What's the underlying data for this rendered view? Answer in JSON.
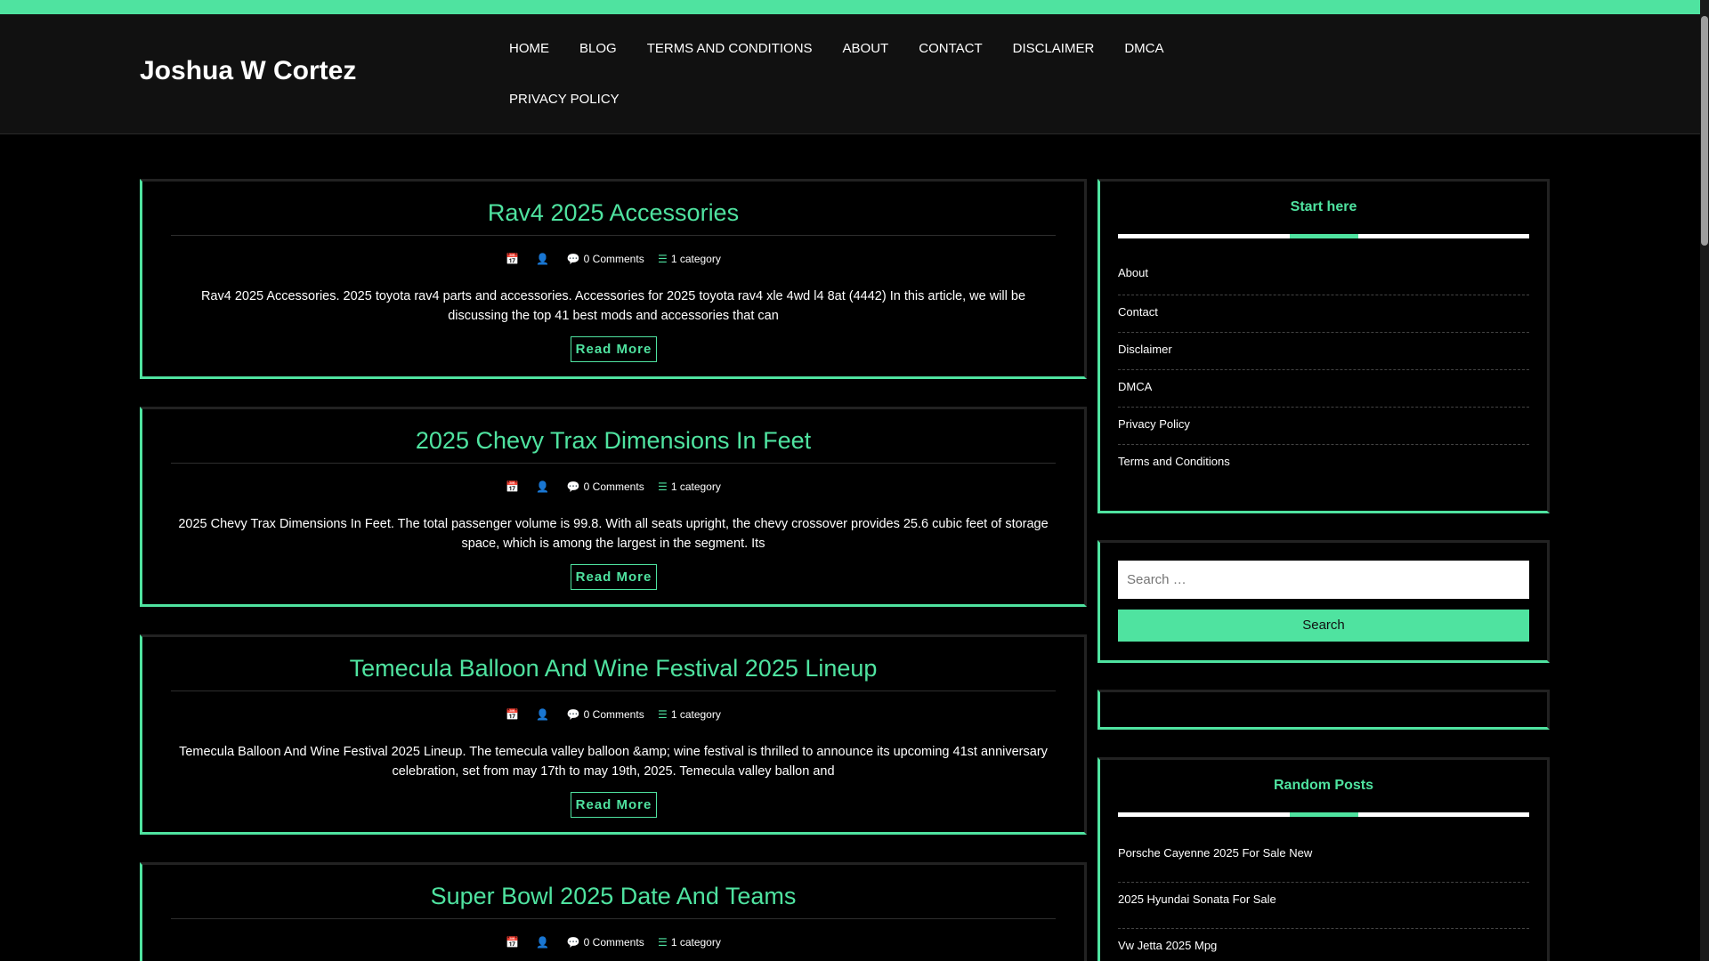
{
  "site": {
    "title": "Joshua W Cortez"
  },
  "nav": {
    "items": [
      "HOME",
      "BLOG",
      "TERMS AND CONDITIONS",
      "ABOUT",
      "CONTACT",
      "DISCLAIMER",
      "DMCA",
      "PRIVACY POLICY"
    ]
  },
  "posts": [
    {
      "title": "Rav4 2025 Accessories",
      "comments": "0 Comments",
      "category": "1 category",
      "excerpt": "Rav4 2025 Accessories. 2025 toyota rav4 parts and accessories. Accessories for 2025 toyota rav4 xle 4wd l4 8at (4442) In this article, we will be discussing the top 41 best mods and accessories that can",
      "read_more": "Read More"
    },
    {
      "title": "2025 Chevy Trax Dimensions In Feet",
      "comments": "0 Comments",
      "category": "1 category",
      "excerpt": "2025 Chevy Trax Dimensions In Feet. The total passenger volume is 99.8. With all seats upright, the chevy crossover provides 25.6 cubic feet of storage space, which is among the largest in the segment. Its",
      "read_more": "Read More"
    },
    {
      "title": "Temecula Balloon And Wine Festival 2025 Lineup",
      "comments": "0 Comments",
      "category": "1 category",
      "excerpt": "Temecula Balloon And Wine Festival 2025 Lineup. The temecula valley balloon &amp; wine festival is thrilled to announce its upcoming 41st anniversary celebration, set from may 17th to may 19th, 2025. Temecula valley ballon and",
      "read_more": "Read More"
    },
    {
      "title": "Super Bowl 2025 Date And Teams",
      "comments": "0 Comments",
      "category": "1 category"
    }
  ],
  "sidebar": {
    "start_here": {
      "title": "Start here",
      "items": [
        "About",
        "Contact",
        "Disclaimer",
        "DMCA",
        "Privacy Policy",
        "Terms and Conditions"
      ]
    },
    "search": {
      "placeholder": "Search …",
      "button": "Search"
    },
    "random_posts": {
      "title": "Random Posts",
      "items": [
        "Porsche Cayenne 2025 For Sale New",
        "2025 Hyundai Sonata For Sale",
        "Vw Jetta 2025 Mpg"
      ]
    }
  },
  "icons": {
    "date": "calendar-icon",
    "author": "user-icon",
    "comments": "comments-icon",
    "category": "list-icon"
  },
  "colors": {
    "accent": "#4fe3a0",
    "background": "#000000",
    "header": "#111111"
  }
}
